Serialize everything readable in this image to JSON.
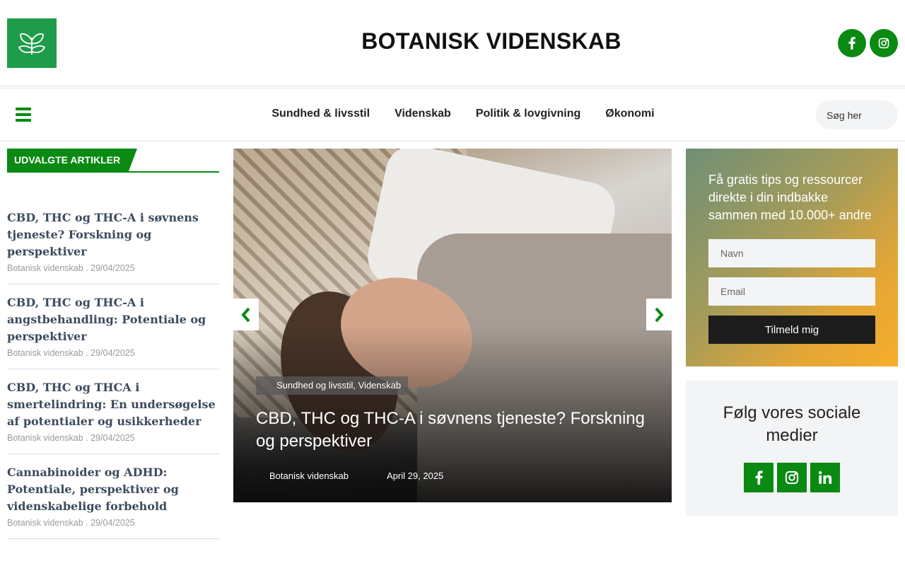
{
  "header": {
    "site_title": "BOTANISK VIDENSKAB",
    "logo_icon": "leaves-icon",
    "social": [
      "facebook-icon",
      "instagram-icon"
    ]
  },
  "nav": {
    "items": [
      "Sundhed & livsstil",
      "Videnskab",
      "Politik & lovgivning",
      "Økonomi"
    ],
    "search_placeholder": "Søg her"
  },
  "featured": {
    "heading": "UDVALGTE ARTIKLER",
    "articles": [
      {
        "title": "CBD, THC og THC-A i søvnens tjeneste? Forskning og perspektiver",
        "meta": "Botanisk videnskab . 29/04/2025"
      },
      {
        "title": "CBD, THC og THC-A i angstbehandling: Potentiale og perspektiver",
        "meta": "Botanisk videnskab . 29/04/2025"
      },
      {
        "title": "CBD, THC og THCA i smertelindring: En undersøgelse af potentialer og usikkerheder",
        "meta": "Botanisk videnskab . 29/04/2025"
      },
      {
        "title": "Cannabinoider og ADHD: Potentiale, perspektiver og videnskabelige forbehold",
        "meta": "Botanisk videnskab . 29/04/2025"
      }
    ]
  },
  "hero": {
    "category": "Sundhed og livsstil, Videnskab",
    "title": "CBD, THC og THC-A i søvnens tjeneste? Forskning og perspektiver",
    "author": "Botanisk videnskab",
    "date": "April 29, 2025"
  },
  "newsletter": {
    "text": "Få gratis tips og ressourcer direkte i din indbakke sammen med 10.000+ andre",
    "name_placeholder": "Navn",
    "email_placeholder": "Email",
    "button_label": "Tilmeld mig"
  },
  "follow": {
    "title": "Følg vores sociale medier",
    "icons": [
      "facebook-icon",
      "instagram-icon",
      "linkedin-icon"
    ]
  },
  "colors": {
    "brand_green": "#0a8a12",
    "logo_green": "#1f9c4a",
    "article_title": "#3c4b5e"
  }
}
